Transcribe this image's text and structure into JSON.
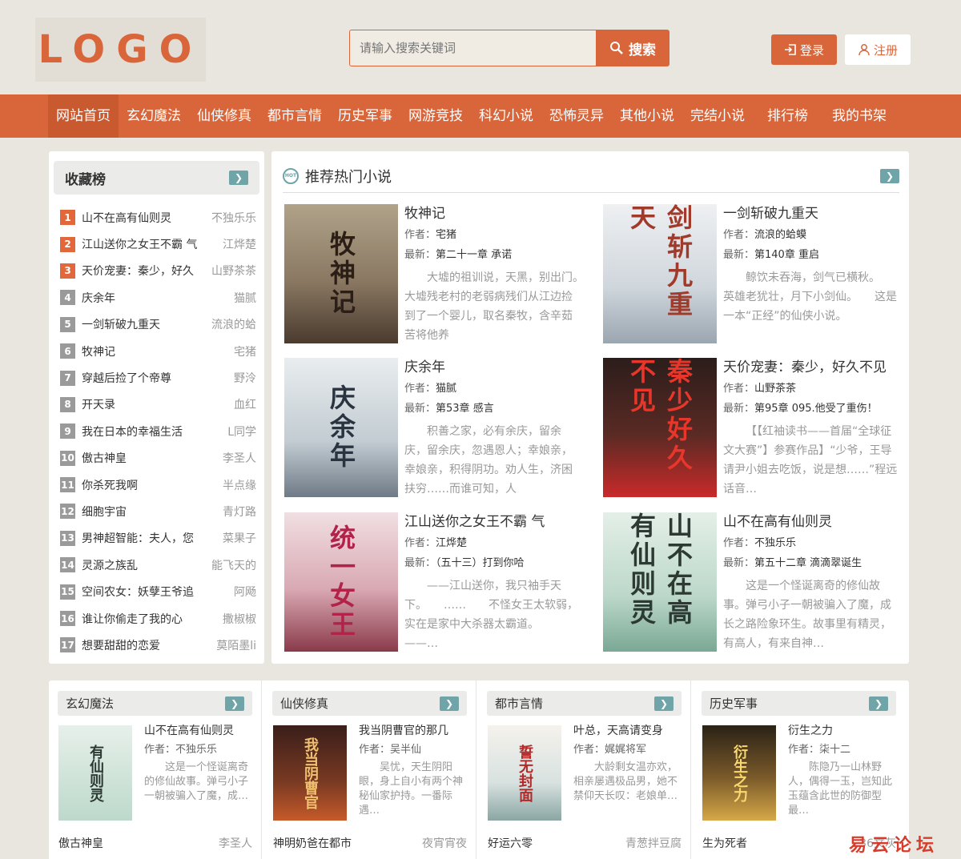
{
  "logo": "LOGO",
  "search": {
    "placeholder": "请输入搜索关键词",
    "button": "搜索"
  },
  "auth": {
    "login": "登录",
    "register": "注册"
  },
  "nav": [
    "网站首页",
    "玄幻魔法",
    "仙侠修真",
    "都市言情",
    "历史军事",
    "网游竞技",
    "科幻小说",
    "恐怖灵异",
    "其他小说",
    "完结小说",
    "排行榜",
    "我的书架"
  ],
  "sidebar": {
    "title": "收藏榜",
    "items": [
      {
        "n": "1",
        "name": "山不在高有仙则灵",
        "author": "不独乐乐"
      },
      {
        "n": "2",
        "name": "江山送你之女王不霸 气",
        "author": "江烨楚"
      },
      {
        "n": "3",
        "name": "天价宠妻：秦少，好久",
        "author": "山野茶茶"
      },
      {
        "n": "4",
        "name": "庆余年",
        "author": "猫腻"
      },
      {
        "n": "5",
        "name": "一剑斩破九重天",
        "author": "流浪的蛤"
      },
      {
        "n": "6",
        "name": "牧神记",
        "author": "宅猪"
      },
      {
        "n": "7",
        "name": "穿越后捡了个帝尊",
        "author": "野泠"
      },
      {
        "n": "8",
        "name": "开天录",
        "author": "血红"
      },
      {
        "n": "9",
        "name": "我在日本的幸福生活",
        "author": "L同学"
      },
      {
        "n": "10",
        "name": "傲古神皇",
        "author": "李圣人"
      },
      {
        "n": "11",
        "name": "你杀死我啊",
        "author": "半点缘"
      },
      {
        "n": "12",
        "name": "细胞宇宙",
        "author": "青灯路"
      },
      {
        "n": "13",
        "name": "男神超智能：夫人，您",
        "author": "菜果子"
      },
      {
        "n": "14",
        "name": "灵源之族乱",
        "author": "能飞天的"
      },
      {
        "n": "15",
        "name": "空间农女：妖孽王爷追",
        "author": "阿飏"
      },
      {
        "n": "16",
        "name": "谁让你偷走了我的心",
        "author": "撒椒椒"
      },
      {
        "n": "17",
        "name": "想要甜甜的恋爱",
        "author": "莫陌墨li"
      }
    ]
  },
  "hot": {
    "title": "推荐热门小说",
    "author_label": "作者：",
    "latest_label": "最新：",
    "books": [
      {
        "title": "牧神记",
        "author": "宅猪",
        "latest": "第二十一章 承诺",
        "desc": "大墟的祖训说，天黑，别出门。　　大墟残老村的老弱病残们从江边捡到了一个婴儿，取名秦牧，含辛茹苦将他养",
        "cover": "牧神记"
      },
      {
        "title": "一剑斩破九重天",
        "author": "流浪的蛤蟆",
        "latest": "第140章 重启",
        "desc": "鲸饮未吞海，剑气已横秋。　　英雄老犹壮，月下小剑仙。　　这是一本“正经”的仙侠小说。",
        "cover": "剑斩九重天"
      },
      {
        "title": "庆余年",
        "author": "猫腻",
        "latest": "第53章 感言",
        "desc": "积善之家，必有余庆，留余庆，留余庆，忽遇恩人；幸娘亲，幸娘亲，积得阴功。劝人生，济困扶穷……而谁可知，人",
        "cover": "庆余年"
      },
      {
        "title": "天价宠妻：秦少，好久不见",
        "author": "山野茶茶",
        "latest": "第95章 095.他受了重伤！",
        "desc": "【【红袖读书——首届“全球征文大赛”】参赛作品】“少爷，王导请尹小姐去吃饭，说是想……”程远话音…",
        "cover": "秦少好久不见"
      },
      {
        "title": "江山送你之女王不霸 气",
        "author": "江烨楚",
        "latest": "（五十三）打到你哈",
        "desc": "——江山送你，我只袖手天下。　　……　　不怪女王太软弱，实在是家中大杀器太霸道。　　——…",
        "cover": "统一女王"
      },
      {
        "title": "山不在高有仙则灵",
        "author": "不独乐乐",
        "latest": "第五十二章 滴滴翠诞生",
        "desc": "这是一个怪诞离奇的修仙故事。弹弓小子一朝被骗入了魔，成长之路险象环生。故事里有精灵，有高人，有来自神…",
        "cover": "山不在高有仙则灵"
      }
    ]
  },
  "categories": [
    {
      "title": "玄幻魔法",
      "book": "山不在高有仙则灵",
      "author": "不独乐乐",
      "desc": "这是一个怪诞离奇的修仙故事。弹弓小子一朝被骗入了魔，成…",
      "cover": "有仙则灵",
      "foot_name": "傲古神皇",
      "foot_author": "李圣人"
    },
    {
      "title": "仙侠修真",
      "book": "我当阴曹官的那几",
      "author": "吴半仙",
      "desc": "吴忧，天生阴阳眼，身上自小有两个神秘仙家护持。一番际遇…",
      "cover": "我当阴曹官",
      "foot_name": "神明奶爸在都市",
      "foot_author": "夜宵宵夜"
    },
    {
      "title": "都市言情",
      "book": "叶总，天高请变身",
      "author": "娓娓将军",
      "desc": "大龄剩女温亦欢，相亲屡遇极品男，她不禁仰天长叹：老娘单…",
      "cover": "誓无封面",
      "foot_name": "好运六零",
      "foot_author": "青葱拌豆腐"
    },
    {
      "title": "历史军事",
      "book": "衍生之力",
      "author": "柒十二",
      "desc": "陈隐乃一山林野人，偶得一玉，岂知此玉蕴含此世的防御型最…",
      "cover": "衍生之力",
      "foot_name": "生为死者",
      "foot_author": "36文灰"
    }
  ],
  "watermark": "易云论坛"
}
